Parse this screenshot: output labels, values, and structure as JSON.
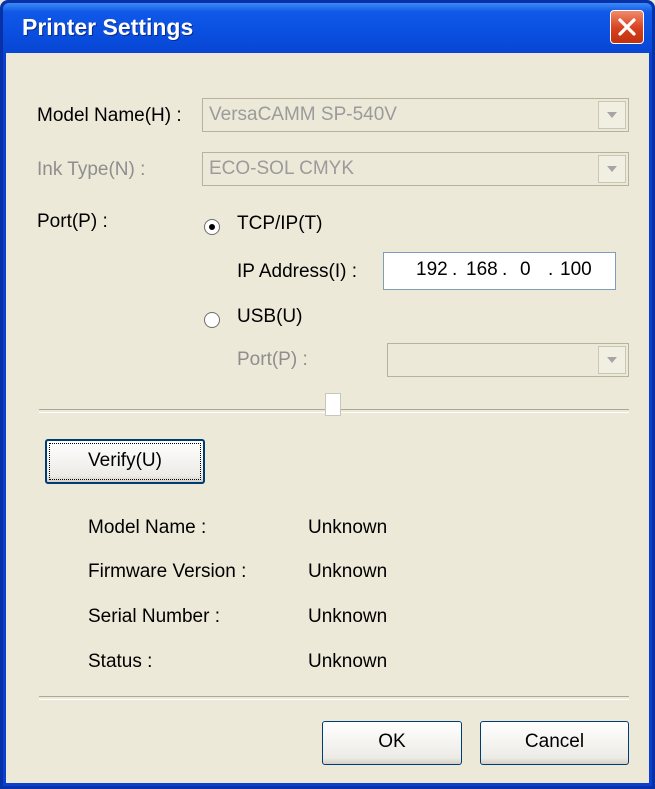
{
  "window": {
    "title": "Printer Settings"
  },
  "model_name": {
    "label": "Model Name(H) :",
    "value": "VersaCAMM SP-540V"
  },
  "ink_type": {
    "label": "Ink Type(N) :",
    "value": "ECO-SOL CMYK"
  },
  "port": {
    "label": "Port(P) :",
    "tcpip_label": "TCP/IP(T)",
    "ip_label": "IP Address(I) :",
    "ip": [
      "192",
      "168",
      "0",
      "100"
    ],
    "usb_label": "USB(U)",
    "usb_port_label": "Port(P) :",
    "usb_port_value": "",
    "selected": "TCP/IP"
  },
  "verify": {
    "label": "Verify(U)"
  },
  "info": [
    {
      "label": "Model Name :",
      "value": "Unknown"
    },
    {
      "label": "Firmware Version :",
      "value": "Unknown"
    },
    {
      "label": "Serial Number :",
      "value": "Unknown"
    },
    {
      "label": "Status :",
      "value": "Unknown"
    }
  ],
  "buttons": {
    "ok": "OK",
    "cancel": "Cancel"
  },
  "colors": {
    "titlebar": "#0a4fe0",
    "close": "#d6401f",
    "face": "#ece9d8"
  },
  "icons": {
    "close": "close-icon",
    "dropdown": "chevron-down-icon"
  }
}
